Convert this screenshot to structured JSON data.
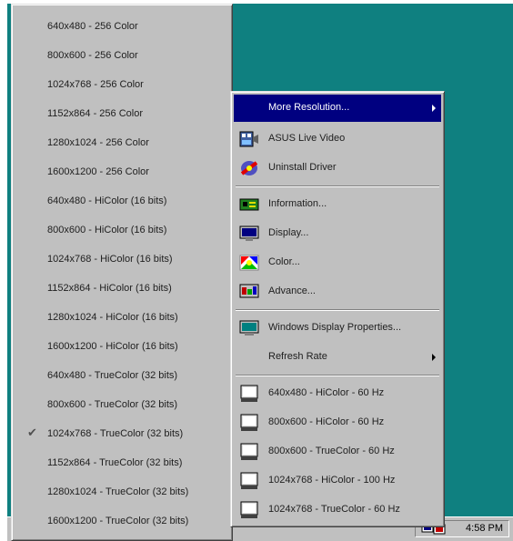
{
  "submenu": {
    "items": [
      {
        "label": "640x480 -  256 Color",
        "checked": false
      },
      {
        "label": "800x600 -  256 Color",
        "checked": false
      },
      {
        "label": "1024x768 -  256 Color",
        "checked": false
      },
      {
        "label": "1152x864 -  256 Color",
        "checked": false
      },
      {
        "label": "1280x1024 -  256 Color",
        "checked": false
      },
      {
        "label": "1600x1200 -  256 Color",
        "checked": false
      },
      {
        "label": "640x480 -  HiColor (16 bits)",
        "checked": false
      },
      {
        "label": "800x600 -  HiColor (16 bits)",
        "checked": false
      },
      {
        "label": "1024x768 -  HiColor (16 bits)",
        "checked": false
      },
      {
        "label": "1152x864 -  HiColor (16 bits)",
        "checked": false
      },
      {
        "label": "1280x1024 -  HiColor (16 bits)",
        "checked": false
      },
      {
        "label": "1600x1200 -  HiColor (16 bits)",
        "checked": false
      },
      {
        "label": "640x480 -  TrueColor (32 bits)",
        "checked": false
      },
      {
        "label": "800x600 -  TrueColor (32 bits)",
        "checked": false
      },
      {
        "label": "1024x768 -  TrueColor (32 bits)",
        "checked": true
      },
      {
        "label": "1152x864 -  TrueColor (32 bits)",
        "checked": false
      },
      {
        "label": "1280x1024 -  TrueColor (32 bits)",
        "checked": false
      },
      {
        "label": "1600x1200 -  TrueColor (32 bits)",
        "checked": false
      }
    ],
    "check_glyph": "✔"
  },
  "mainmenu": {
    "more_resolution": "More Resolution...",
    "asus_live_video": "ASUS Live Video",
    "uninstall_driver": "Uninstall Driver",
    "information": "Information...",
    "display": "Display...",
    "color": "Color...",
    "advance": "Advance...",
    "windows_display_properties": "Windows Display Properties...",
    "refresh_rate": "Refresh Rate",
    "presets": [
      "640x480 -  HiColor - 60 Hz",
      "800x600 -  HiColor - 60 Hz",
      "800x600 -  TrueColor - 60 Hz",
      "1024x768 -  HiColor - 100 Hz",
      "1024x768 -  TrueColor - 60 Hz"
    ]
  },
  "taskbar": {
    "clock": "4:58 PM"
  },
  "colors": {
    "desktop": "#0f8080",
    "menu_face": "#c0c0c0",
    "highlight": "#000080"
  },
  "icons": {
    "asus_live_video": "film-camera-icon",
    "uninstall_driver": "uninstall-icon",
    "information": "info-card-icon",
    "display": "monitor-icon",
    "color": "color-palette-icon",
    "advance": "advance-tools-icon",
    "windows_display_properties": "desktop-monitor-icon",
    "presets": "monitor-preset-icon",
    "tray": "display-tray-icon"
  }
}
